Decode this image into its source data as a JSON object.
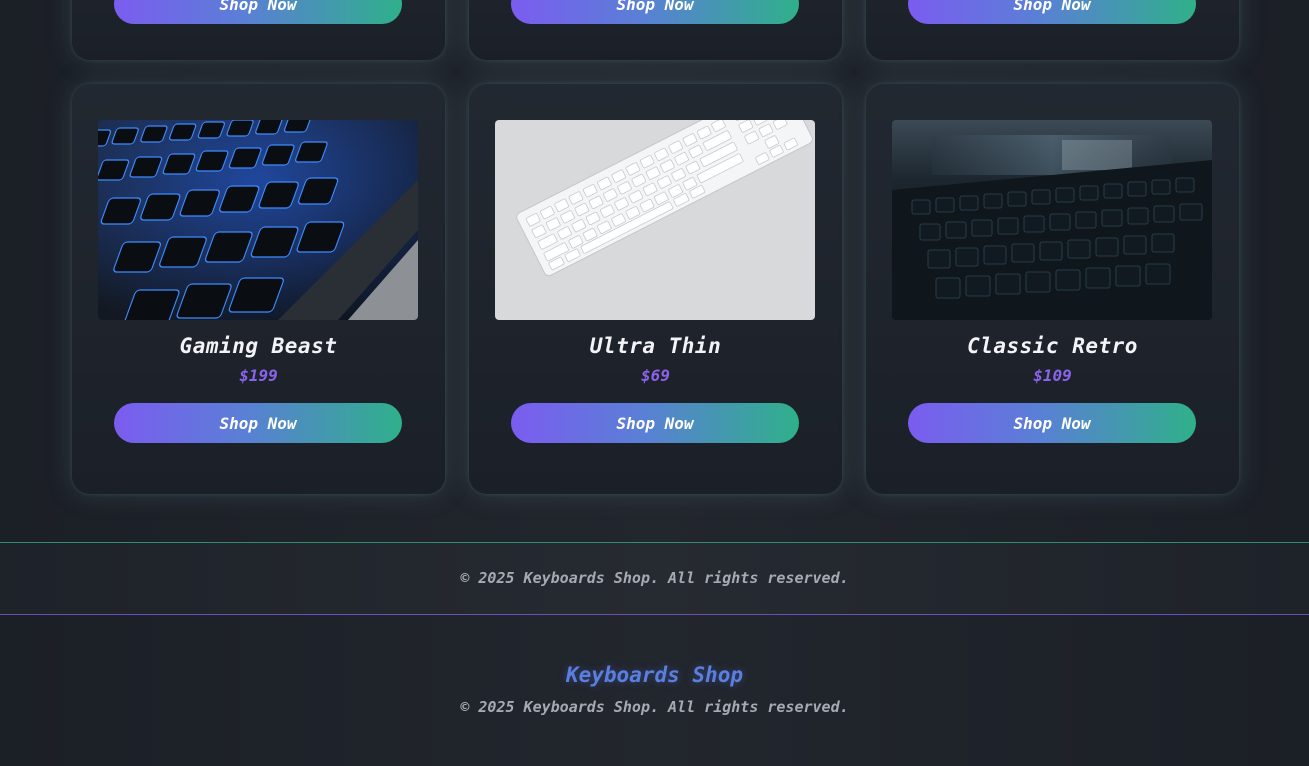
{
  "products_top": [
    {
      "button_label": "Shop Now"
    },
    {
      "button_label": "Shop Now"
    },
    {
      "button_label": "Shop Now"
    }
  ],
  "products": [
    {
      "name": "Gaming Beast",
      "price": "$199",
      "button_label": "Shop Now"
    },
    {
      "name": "Ultra Thin",
      "price": "$69",
      "button_label": "Shop Now"
    },
    {
      "name": "Classic Retro",
      "price": "$109",
      "button_label": "Shop Now"
    }
  ],
  "copyright_bar": {
    "text": "© 2025 Keyboards Shop. All rights reserved."
  },
  "footer": {
    "brand": "Keyboards Shop",
    "copyright": "© 2025 Keyboards Shop. All rights reserved."
  },
  "colors": {
    "accent_purple": "#7b5cf0",
    "accent_green": "#2fb08a",
    "price": "#8a63ea",
    "background": "#1b1f26"
  }
}
